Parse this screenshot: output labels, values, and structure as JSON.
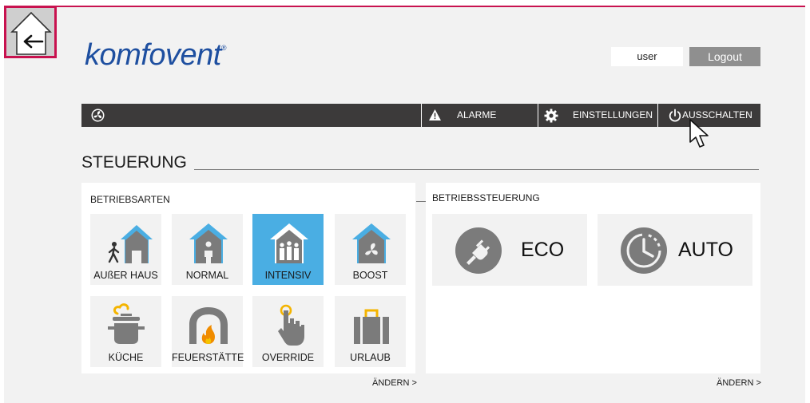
{
  "brand": {
    "name": "komfovent",
    "mark": "®"
  },
  "header": {
    "user_label": "user",
    "logout_label": "Logout"
  },
  "nav": {
    "alarms_label": "ALARME",
    "settings_label": "EINSTELLUNGEN",
    "power_label": "AUSSCHALTEN"
  },
  "section": {
    "title": "STEUERUNG"
  },
  "modes": {
    "label": "BETRIEBSARTEN",
    "items": [
      {
        "label": "AUßER HAUS",
        "icon": "away-home-icon",
        "active": false
      },
      {
        "label": "NORMAL",
        "icon": "normal-home-icon",
        "active": false
      },
      {
        "label": "INTENSIV",
        "icon": "intensive-home-icon",
        "active": true
      },
      {
        "label": "BOOST",
        "icon": "boost-fan-home-icon",
        "active": false
      },
      {
        "label": "KÜCHE",
        "icon": "kitchen-pot-icon",
        "active": false
      },
      {
        "label": "FEUERSTÄTTE",
        "icon": "fireplace-icon",
        "active": false
      },
      {
        "label": "OVERRIDE",
        "icon": "override-hand-icon",
        "active": false
      },
      {
        "label": "URLAUB",
        "icon": "suitcase-icon",
        "active": false
      }
    ],
    "change_label": "ÄNDERN >"
  },
  "control": {
    "label": "BETRIEBSSTEUERUNG",
    "items": [
      {
        "label": "ECO",
        "icon": "eco-plug-icon"
      },
      {
        "label": "AUTO",
        "icon": "auto-clock-icon"
      }
    ],
    "change_label": "ÄNDERN >"
  },
  "colors": {
    "accent": "#c8124f",
    "active_tile": "#4aaee3",
    "navbar": "#3c3a3a",
    "brand": "#1e4fa0"
  }
}
